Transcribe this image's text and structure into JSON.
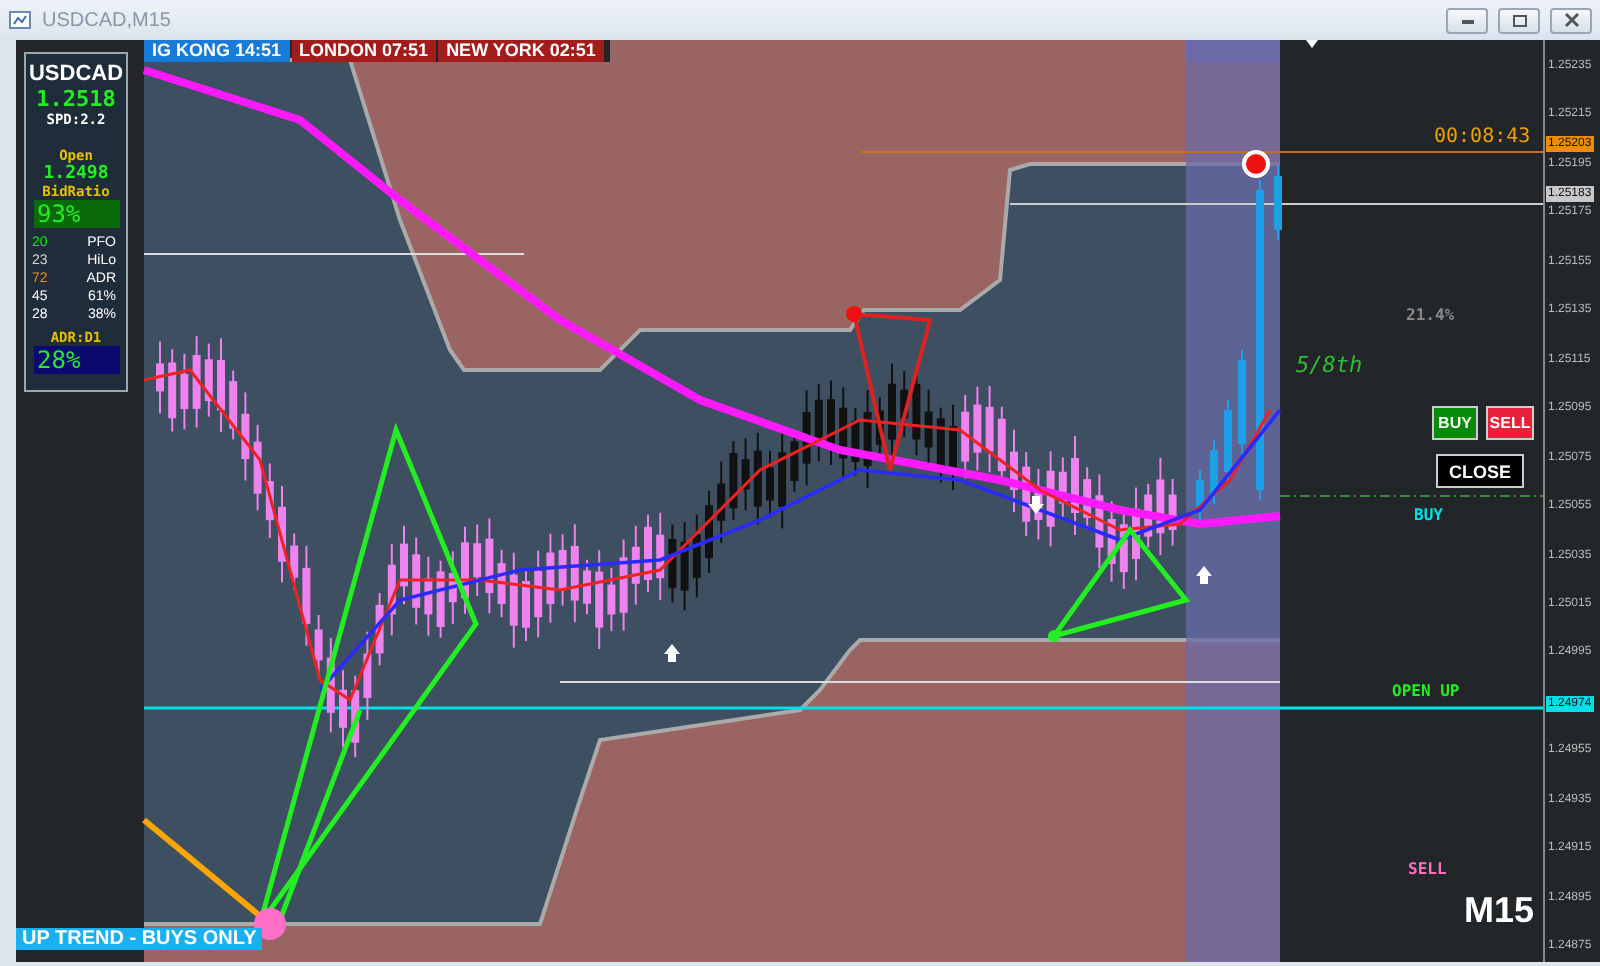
{
  "window": {
    "title": "USDCAD,M15"
  },
  "sessions": [
    {
      "label": "IG KONG 14:51",
      "color": "#1a7ad8"
    },
    {
      "label": "LONDON 07:51",
      "color": "#a31c1c"
    },
    {
      "label": "NEW YORK 02:51",
      "color": "#a31c1c"
    }
  ],
  "info_panel": {
    "symbol": "USDCAD",
    "price": "1.2518",
    "spread": "SPD:2.2",
    "open_label": "Open",
    "open_price": "1.2498",
    "bid_ratio_label": "BidRatio",
    "bid_ratio": "93%",
    "adr_label": "ADR:D1",
    "adr": "28%",
    "stats": [
      {
        "value": "20",
        "label": "PFO",
        "color": "#22dd22"
      },
      {
        "value": "23",
        "label": "HiLo",
        "color": "#d8d8d8"
      },
      {
        "value": "72",
        "label": "ADR",
        "color": "#f08c1a"
      },
      {
        "value": "45",
        "label": "61%",
        "color": "#ffffff"
      },
      {
        "value": "28",
        "label": "38%",
        "color": "#ffffff"
      }
    ]
  },
  "timer": "00:08:43",
  "percent": "21.4%",
  "level_text": "5/8th",
  "buttons": [
    {
      "label": "BUY",
      "kind": "buy"
    },
    {
      "label": "SELL",
      "kind": "sell"
    },
    {
      "label": "CLOSE",
      "kind": "close"
    }
  ],
  "zone_labels": [
    {
      "label": "BUY",
      "kind": "buy"
    },
    {
      "label": "OPEN UP",
      "kind": "open"
    },
    {
      "label": "SELL",
      "kind": "sell"
    }
  ],
  "timeframe": "M15",
  "trend_banner": "UP TREND - BUYS ONLY",
  "price_axis": [
    {
      "label": "1.25235",
      "kind": "tick"
    },
    {
      "label": "1.25215",
      "kind": "tick"
    },
    {
      "label": "1.25203",
      "kind": "marker",
      "color": "#f08c00"
    },
    {
      "label": "1.25195",
      "kind": "tick"
    },
    {
      "label": "1.25183",
      "kind": "marker",
      "color": "#c8c8c8"
    },
    {
      "label": "1.25175",
      "kind": "tick"
    },
    {
      "label": "1.25155",
      "kind": "tick"
    },
    {
      "label": "1.25135",
      "kind": "tick"
    },
    {
      "label": "1.25115",
      "kind": "tick"
    },
    {
      "label": "1.25095",
      "kind": "tick"
    },
    {
      "label": "1.25075",
      "kind": "tick"
    },
    {
      "label": "1.25055",
      "kind": "tick"
    },
    {
      "label": "1.25035",
      "kind": "tick"
    },
    {
      "label": "1.25015",
      "kind": "tick"
    },
    {
      "label": "1.24995",
      "kind": "tick"
    },
    {
      "label": "1.24974",
      "kind": "marker",
      "color": "#00e0e8"
    },
    {
      "label": "1.24955",
      "kind": "tick"
    },
    {
      "label": "1.24935",
      "kind": "tick"
    },
    {
      "label": "1.24915",
      "kind": "tick"
    },
    {
      "label": "1.24895",
      "kind": "tick"
    },
    {
      "label": "1.24875",
      "kind": "tick"
    }
  ]
}
